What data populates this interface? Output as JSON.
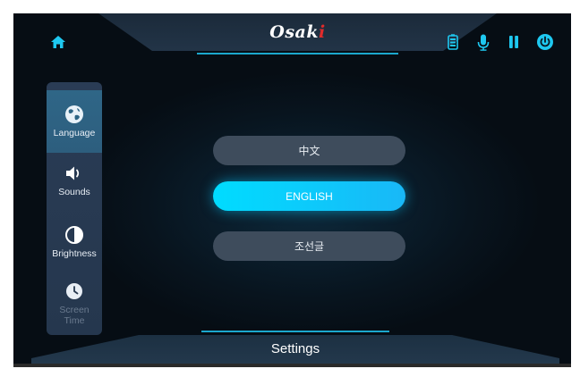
{
  "header": {
    "brand_main": "Osak",
    "brand_dot": "i"
  },
  "top_icons": {
    "home": "home-icon",
    "battery": "battery-icon",
    "microphone": "microphone-icon",
    "pause": "pause-icon",
    "power": "power-icon"
  },
  "sidebar": {
    "items": [
      {
        "label": "Language",
        "icon": "globe-icon",
        "active": true
      },
      {
        "label": "Sounds",
        "icon": "speaker-icon",
        "active": false
      },
      {
        "label": "Brightness",
        "icon": "brightness-icon",
        "active": false
      },
      {
        "label": "Screen",
        "label2": "Time",
        "icon": "clock-icon",
        "active": false,
        "dimmed": true
      }
    ]
  },
  "languages": [
    {
      "label": "中文",
      "selected": false
    },
    {
      "label": "ENGLISH",
      "selected": true
    },
    {
      "label": "조선글",
      "selected": false
    }
  ],
  "footer": {
    "title": "Settings"
  },
  "colors": {
    "accent": "#00dcff",
    "brand_dot": "#e02b2b",
    "icon_cyan": "#1ec8f0"
  }
}
